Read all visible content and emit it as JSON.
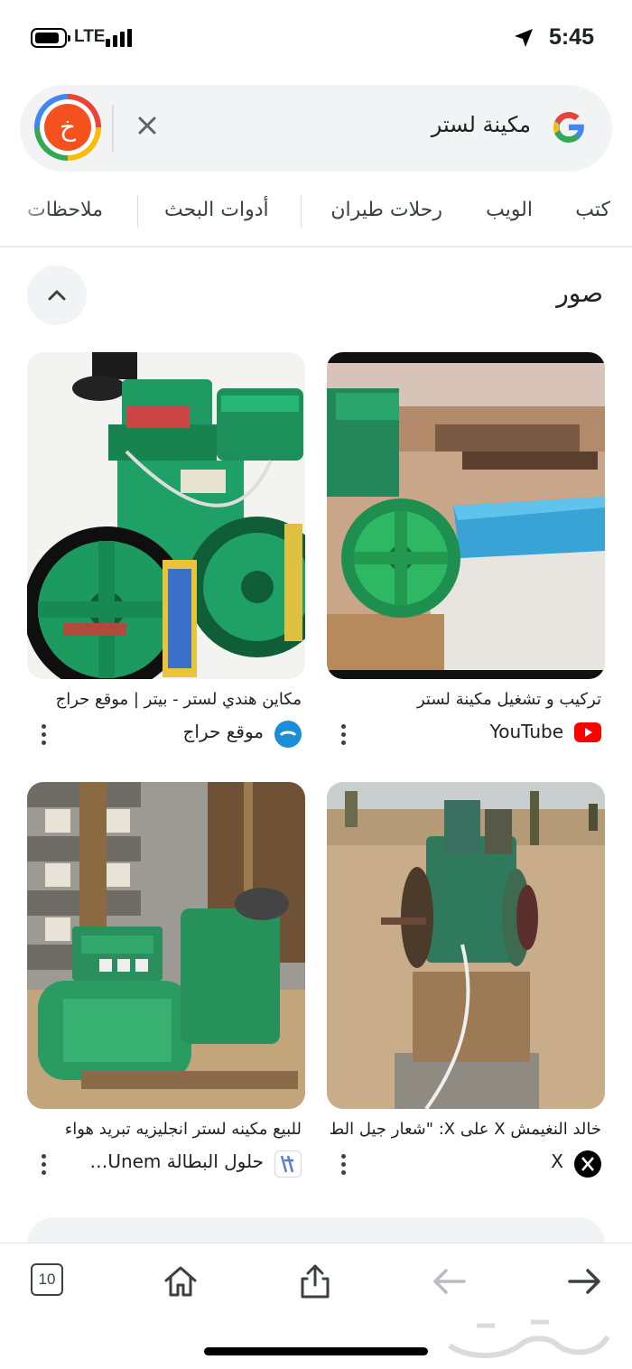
{
  "status_bar": {
    "network": "LTE",
    "time": "5:45"
  },
  "search": {
    "query": "مكينة لستر",
    "avatar_letter": "خ",
    "clear_icon": "close-icon",
    "logo": "google-logo"
  },
  "tabs": [
    {
      "label": "كتب"
    },
    {
      "label": "الويب"
    },
    {
      "label": "رحلات طيران"
    },
    {
      "label": "أدوات البحث"
    },
    {
      "label": "ملاحظات"
    }
  ],
  "images_section": {
    "title": "صور",
    "collapse_icon": "chevron-up-icon"
  },
  "results": [
    {
      "title": "تركيب و تشغيل مكينة لستر",
      "source": "YouTube",
      "source_icon": "youtube-icon",
      "source_color": "#ff0000"
    },
    {
      "title": "مكاين هندي لستر - بيتر | موقع حراج",
      "source": "موقع حراج",
      "source_icon": "haraj-icon",
      "source_color": "#1b8fd6"
    },
    {
      "title": "خالد النغيمش X على X: \"شعار جيل الطيبي",
      "source": "X",
      "source_icon": "x-icon",
      "source_color": "#000000"
    },
    {
      "title": "للبيع مكينه لستر انجليزيه تبريد هواء",
      "source": "حلول البطالة Unem…",
      "source_icon": "site-favicon-icon",
      "source_color": "#5a7fc6"
    }
  ],
  "toolbar": {
    "tab_count": "10",
    "items": [
      "tabs-icon",
      "home-icon",
      "share-icon",
      "back-arrow-icon",
      "forward-arrow-icon"
    ]
  },
  "colors": {
    "accent_orange": "#f4511e",
    "search_bg": "#f1f3f4",
    "engine_green": "#1f9a5a"
  }
}
